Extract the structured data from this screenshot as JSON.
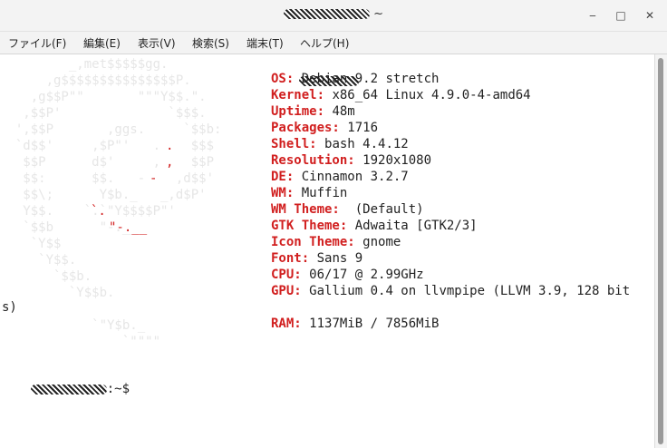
{
  "window": {
    "title_suffix": "~",
    "buttons": {
      "minimize": "‒",
      "maximize": "□",
      "close": "✕"
    }
  },
  "menu": [
    "ファイル(F)",
    "編集(E)",
    "表示(V)",
    "検索(S)",
    "端末(T)",
    "ヘルプ(H)"
  ],
  "logo_lines": [
    "         _,met$$$$$gg.",
    "      ,g$$$$$$$$$$$$$$$P.",
    "    ,g$$P\"\"       \"\"\"Y$$.\".",
    "   ,$$P'              `$$$.",
    "  ',$$P       ,ggs.     `$$b:",
    "  `d$$'     ,$P\"'   .    $$$",
    "   $$P      d$'     ,    $$P",
    "   $$:      $$.   -    ,d$$'",
    "   $$\\;      Y$b._   _,d$P'",
    "   Y$$.    `.`\"Y$$$$P\"'",
    "   `$$b      \"-.__",
    "    `Y$$",
    "     `Y$$.",
    "       `$$b.",
    "         `Y$$b.",
    "",
    "            `\"Y$b._",
    "                `\"\"\"\""
  ],
  "logo_red_marks": [
    ".",
    ",",
    "-",
    "`.",
    "\"-.__"
  ],
  "info": [
    {
      "key": "OS:",
      "value": "Debian 9.2 stretch"
    },
    {
      "key": "Kernel:",
      "value": "x86_64 Linux 4.9.0-4-amd64"
    },
    {
      "key": "Uptime:",
      "value": "48m"
    },
    {
      "key": "Packages:",
      "value": "1716"
    },
    {
      "key": "Shell:",
      "value": "bash 4.4.12"
    },
    {
      "key": "Resolution:",
      "value": "1920x1080"
    },
    {
      "key": "DE:",
      "value": "Cinnamon 3.2.7"
    },
    {
      "key": "WM:",
      "value": "Muffin"
    },
    {
      "key": "WM Theme:",
      "value": " (Default)"
    },
    {
      "key": "GTK Theme:",
      "value": "Adwaita [GTK2/3]"
    },
    {
      "key": "Icon Theme:",
      "value": "gnome"
    },
    {
      "key": "Font:",
      "value": "Sans 9"
    },
    {
      "key": "CPU:",
      "value": "06/17 @ 2.99GHz"
    },
    {
      "key": "GPU:",
      "value": "Gallium 0.4 on llvmpipe (LLVM 3.9, 128 bit"
    }
  ],
  "gpu_wrap": "s)",
  "ram": {
    "key": "RAM:",
    "value": "1137MiB / 7856MiB"
  },
  "prompt": ":~$"
}
